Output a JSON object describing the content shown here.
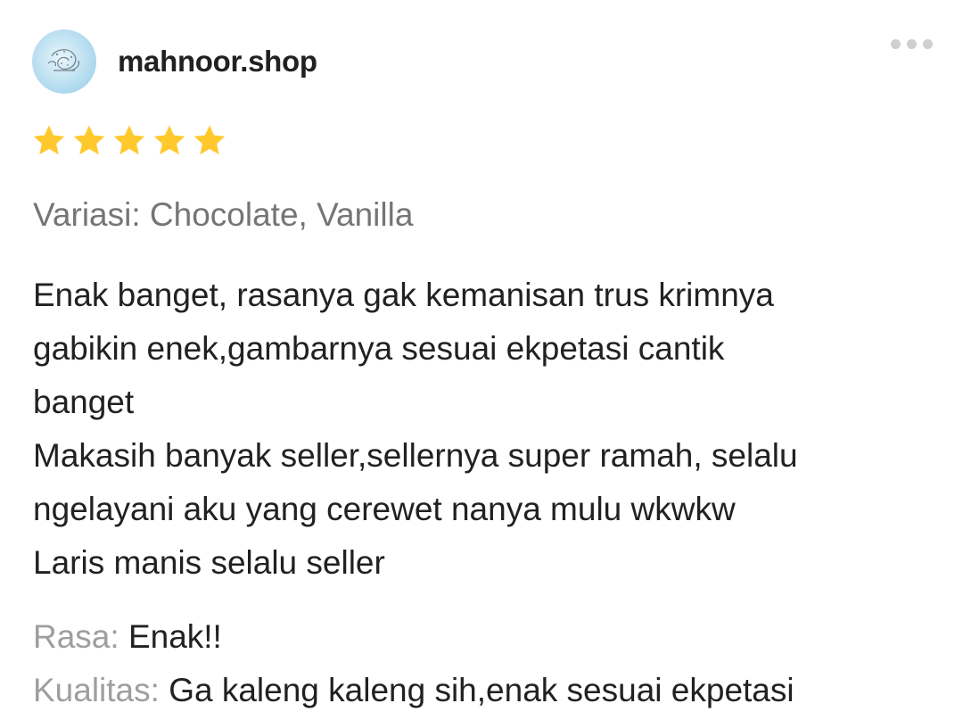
{
  "shop": {
    "name": "mahnoor.shop",
    "avatar_icon": "shop-logo-avatar"
  },
  "rating": {
    "value": 5,
    "max": 5,
    "star_color": "#FFC82C"
  },
  "variation": {
    "label": "Variasi:",
    "value": "Chocolate, Vanilla",
    "text": "Variasi: Chocolate, Vanilla"
  },
  "review": {
    "lines": [
      "Enak banget, rasanya gak kemanisan trus krimnya",
      "gabikin enek,gambarnya sesuai ekpetasi cantik",
      "banget",
      "Makasih banyak seller,sellernya super ramah, selalu",
      "ngelayani aku yang cerewet nanya mulu wkwkw",
      "Laris manis selalu seller"
    ]
  },
  "attributes": [
    {
      "label": "Rasa:",
      "value": "Enak!!"
    },
    {
      "label": "Kualitas:",
      "value": "Ga kaleng kaleng sih,enak sesuai ekpetasi"
    }
  ],
  "menu": {
    "icon": "more-horizontal-icon"
  }
}
